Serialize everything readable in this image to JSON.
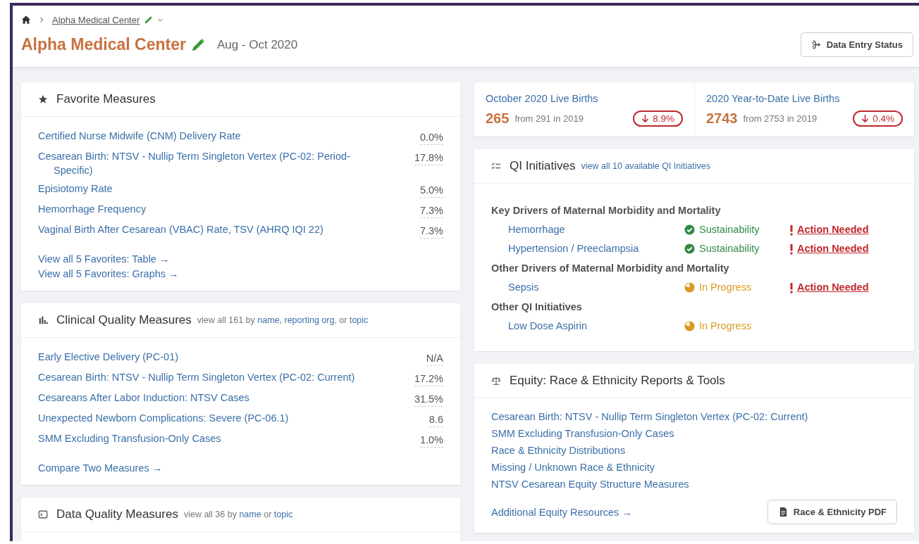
{
  "breadcrumb": {
    "current": "Alpha Medical Center"
  },
  "header": {
    "title": "Alpha Medical Center",
    "period": "Aug - Oct 2020",
    "button": "Data Entry Status"
  },
  "favorites": {
    "title": "Favorite Measures",
    "rows": [
      {
        "name": "Certified Nurse Midwife (CNM) Delivery Rate",
        "value": "0.0%"
      },
      {
        "name": "Cesarean Birth: NTSV - Nullip Term Singleton Vertex (PC-02: Period-Specific)",
        "value": "17.8%"
      },
      {
        "name": "Episiotomy Rate",
        "value": "5.0%"
      },
      {
        "name": "Hemorrhage Frequency",
        "value": "7.3%"
      },
      {
        "name": "Vaginal Birth After Cesarean (VBAC) Rate, TSV (AHRQ IQI 22)",
        "value": "7.3%"
      }
    ],
    "links": [
      "View all 5 Favorites: Table →",
      "View all 5 Favorites: Graphs →"
    ]
  },
  "clinical": {
    "title": "Clinical Quality Measures",
    "note": [
      {
        "kind": "text",
        "text": "view all 161 by "
      },
      {
        "kind": "link",
        "text": "name"
      },
      {
        "kind": "text",
        "text": ", "
      },
      {
        "kind": "link",
        "text": "reporting org"
      },
      {
        "kind": "text",
        "text": ", or "
      },
      {
        "kind": "link",
        "text": "topic"
      }
    ],
    "rows": [
      {
        "name": "Early Elective Delivery (PC-01)",
        "value": "N/A"
      },
      {
        "name": "Cesarean Birth: NTSV - Nullip Term Singleton Vertex (PC-02: Current)",
        "value": "17.2%"
      },
      {
        "name": "Cesareans After Labor Induction: NTSV Cases",
        "value": "31.5%"
      },
      {
        "name": "Unexpected Newborn Complications: Severe (PC-06.1)",
        "value": "8.6"
      },
      {
        "name": "SMM Excluding Transfusion-Only Cases",
        "value": "1.0%"
      }
    ],
    "links": [
      "Compare Two Measures →"
    ]
  },
  "data_quality": {
    "title": "Data Quality Measures",
    "note": [
      {
        "kind": "text",
        "text": "view all 36 by "
      },
      {
        "kind": "link",
        "text": "name"
      },
      {
        "kind": "text",
        "text": " or "
      },
      {
        "kind": "link",
        "text": "topic"
      }
    ]
  },
  "stats": [
    {
      "title": "October 2020 Live Births",
      "value": "265",
      "from": "from 291 in 2019",
      "change": "8.9%",
      "decrease": true
    },
    {
      "title": "2020 Year-to-Date Live Births",
      "value": "2743",
      "from": "from 2753 in 2019",
      "change": "0.4%",
      "decrease": true
    }
  ],
  "qi": {
    "title": "QI Initiatives",
    "link": "view all 10 available QI Initiatives",
    "groups": [
      {
        "title": "Key Drivers of Maternal Morbidity and Mortality",
        "items": [
          {
            "name": "Hemorrhage",
            "status": "Sustainability",
            "kind": "done",
            "action": "Action Needed"
          },
          {
            "name": "Hypertension / Preeclampsia",
            "status": "Sustainability",
            "kind": "done",
            "action": "Action Needed"
          }
        ]
      },
      {
        "title": "Other Drivers of Maternal Morbidity and Mortality",
        "items": [
          {
            "name": "Sepsis",
            "status": "In Progress",
            "kind": "progress",
            "action": "Action Needed"
          }
        ]
      },
      {
        "title": "Other QI Initiatives",
        "items": [
          {
            "name": "Low Dose Aspirin",
            "status": "In Progress",
            "kind": "progress"
          }
        ]
      }
    ]
  },
  "equity": {
    "title": "Equity: Race & Ethnicity Reports & Tools",
    "links": [
      "Cesarean Birth: NTSV - Nullip Term Singleton Vertex (PC-02: Current)",
      "SMM Excluding Transfusion-Only Cases",
      "Race & Ethnicity Distributions",
      "Missing / Unknown Race & Ethnicity",
      "NTSV Cesarean Equity Structure Measures"
    ],
    "footer_link": "Additional Equity Resources →",
    "button": "Race & Ethnicity PDF"
  }
}
